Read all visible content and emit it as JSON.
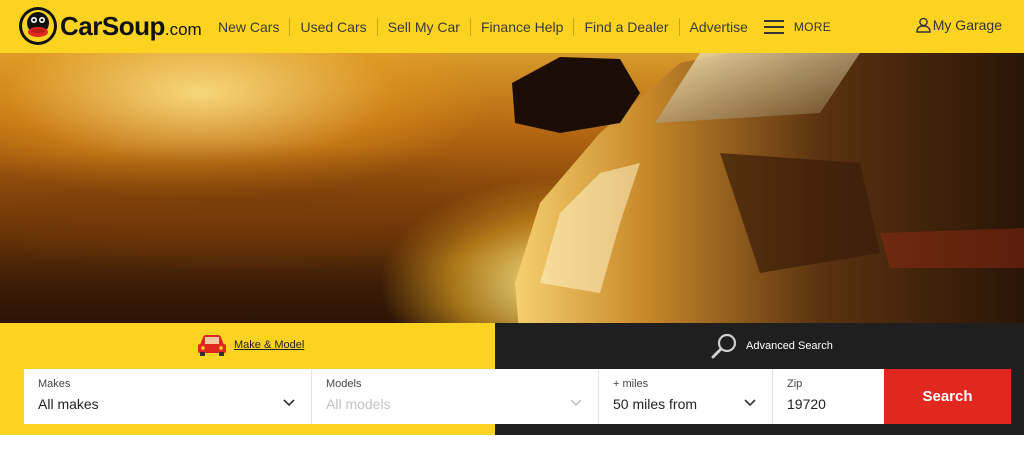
{
  "brand": {
    "name_main": "CarSoup",
    "name_suffix": ".com",
    "logo_icon": "duck-mascot-icon",
    "primary_color": "#fdd321",
    "accent_color": "#e0281f"
  },
  "nav": {
    "items": [
      {
        "label": "New Cars"
      },
      {
        "label": "Used Cars"
      },
      {
        "label": "Sell My Car"
      },
      {
        "label": "Finance Help"
      },
      {
        "label": "Find a Dealer"
      },
      {
        "label": "Advertise"
      }
    ],
    "more_label": "MORE",
    "garage_label": "My Garage",
    "garage_icon": "user-icon"
  },
  "search": {
    "tabs": [
      {
        "label": "Make & Model",
        "icon": "car-icon",
        "active": true
      },
      {
        "label": "Advanced Search",
        "icon": "magnifier-icon",
        "active": false
      }
    ],
    "fields": {
      "makes": {
        "label": "Makes",
        "value": "All makes"
      },
      "models": {
        "label": "Models",
        "value": "All models",
        "disabled": true
      },
      "miles": {
        "label": "+ miles",
        "value": "50 miles from"
      },
      "zip": {
        "label": "Zip",
        "value": "19720"
      }
    },
    "submit_label": "Search"
  }
}
